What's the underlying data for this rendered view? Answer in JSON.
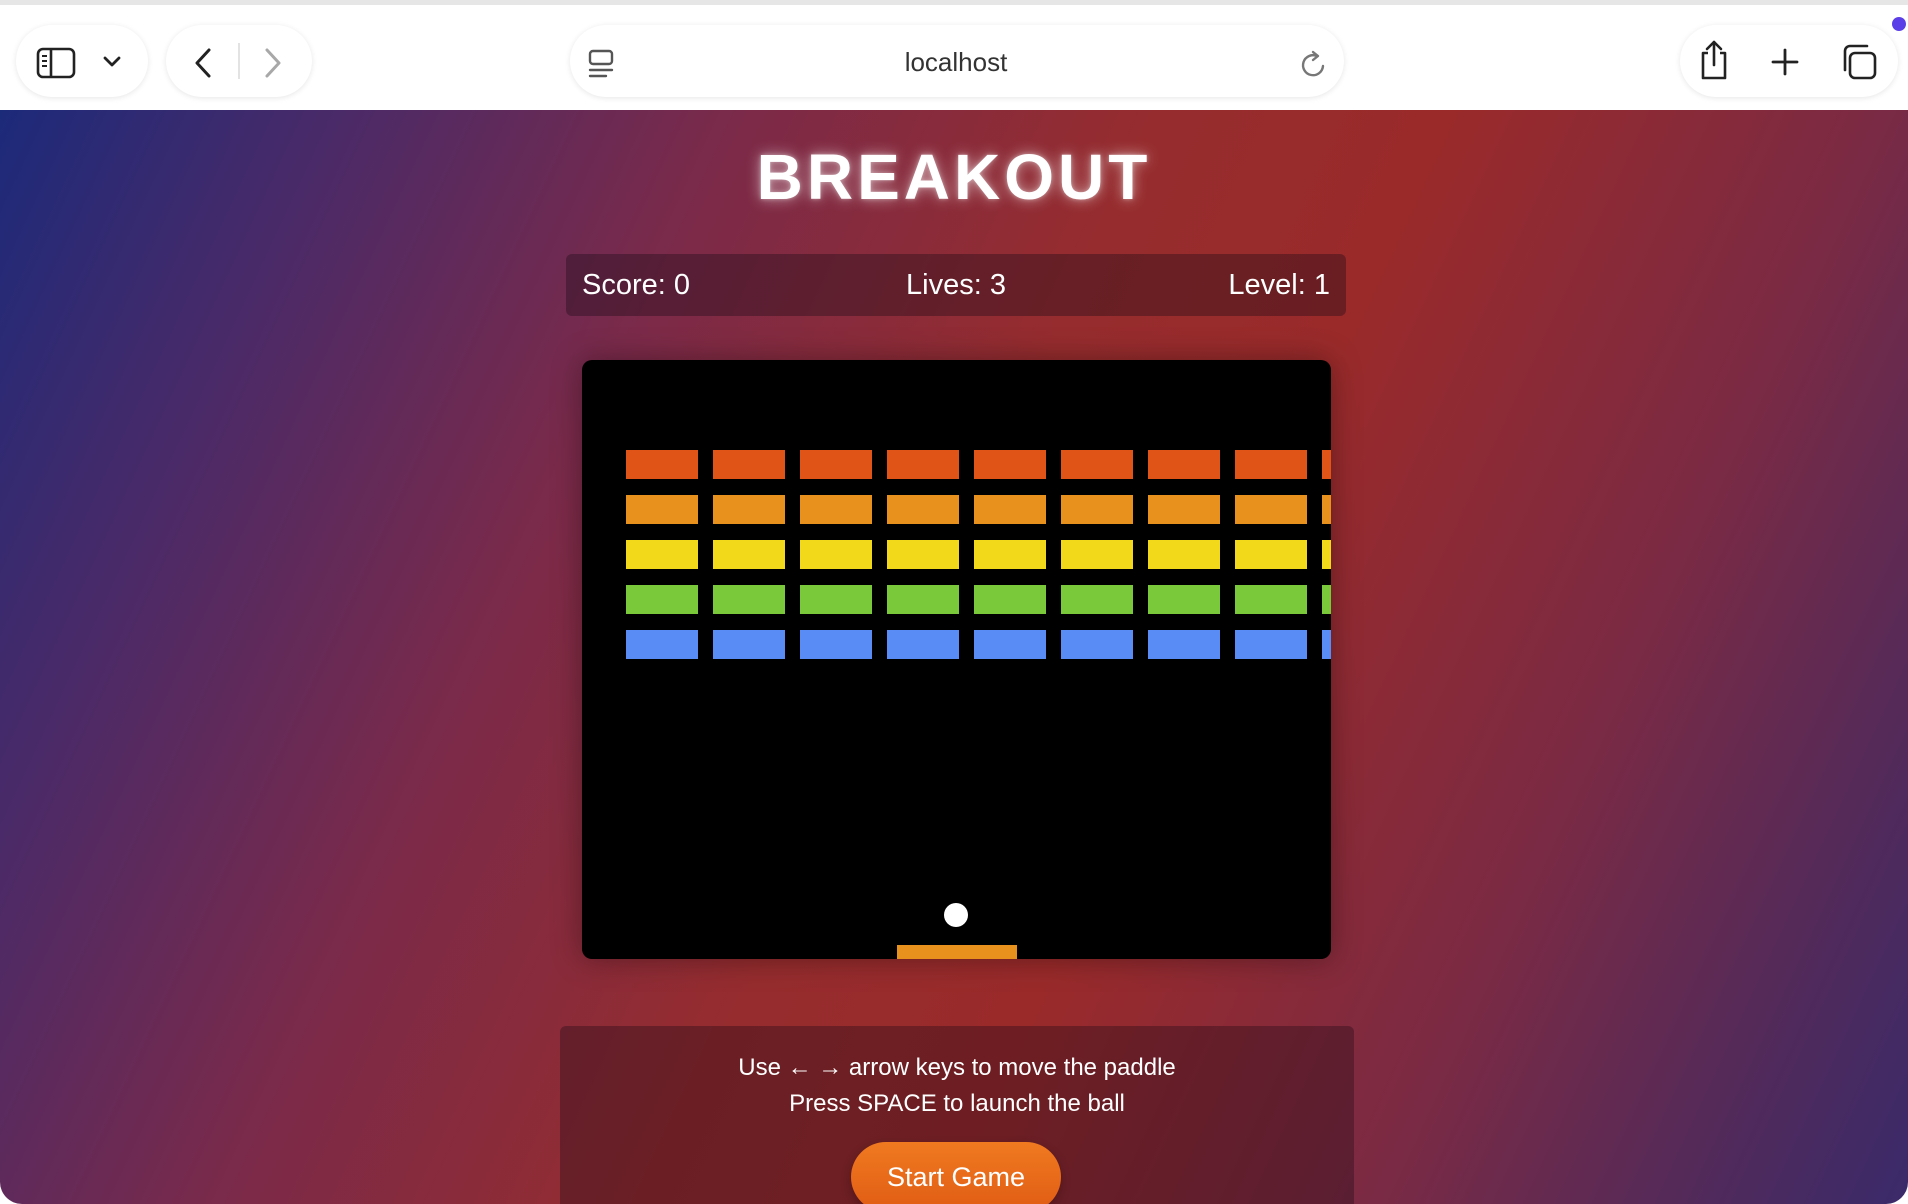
{
  "browser": {
    "url": "localhost",
    "icons": {
      "sidebar": "sidebar-icon",
      "tabs_menu": "chevron-down-icon",
      "back": "back-arrow-icon",
      "forward": "forward-arrow-icon",
      "page_menu": "page-menu-icon",
      "reload": "reload-icon",
      "share": "share-icon",
      "new_tab": "plus-icon",
      "tab_overview": "tabs-overview-icon"
    }
  },
  "game": {
    "title": "BREAKOUT",
    "score_text": "Score: 0",
    "lives_text": "Lives: 3",
    "level_text": "Level: 1",
    "instructions": {
      "line1": "Use ← → arrow keys to move the paddle",
      "line2": "Press SPACE to launch the ball"
    },
    "start_button": "Start Game",
    "bricks": {
      "rows": 5,
      "columns_visible": 9,
      "row_colors": [
        "#e05418",
        "#e8911c",
        "#f2d91a",
        "#79c93a",
        "#5a8cf5"
      ]
    },
    "paddle_color": "#e8911c",
    "ball_color": "#ffffff",
    "board_color": "#000000"
  }
}
